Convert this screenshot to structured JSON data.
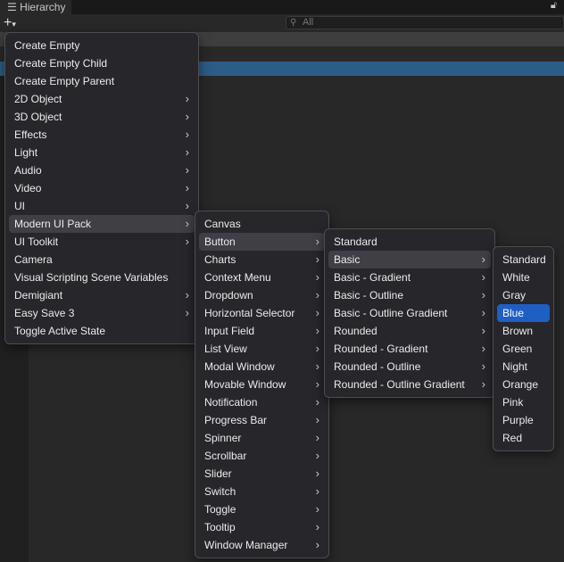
{
  "window": {
    "tab_title": "Hierarchy",
    "search_placeholder": "All"
  },
  "menu1": [
    {
      "label": "Create Empty",
      "sub": false
    },
    {
      "label": "Create Empty Child",
      "sub": false
    },
    {
      "label": "Create Empty Parent",
      "sub": false
    },
    {
      "label": "2D Object",
      "sub": true
    },
    {
      "label": "3D Object",
      "sub": true
    },
    {
      "label": "Effects",
      "sub": true
    },
    {
      "label": "Light",
      "sub": true
    },
    {
      "label": "Audio",
      "sub": true
    },
    {
      "label": "Video",
      "sub": true
    },
    {
      "label": "UI",
      "sub": true
    },
    {
      "label": "Modern UI Pack",
      "sub": true,
      "active": true
    },
    {
      "label": "UI Toolkit",
      "sub": true
    },
    {
      "label": "Camera",
      "sub": false
    },
    {
      "label": "Visual Scripting Scene Variables",
      "sub": false
    },
    {
      "label": "Demigiant",
      "sub": true
    },
    {
      "label": "Easy Save 3",
      "sub": true
    },
    {
      "label": "Toggle Active State",
      "sub": false
    }
  ],
  "menu2": [
    {
      "label": "Canvas",
      "sub": false
    },
    {
      "label": "Button",
      "sub": true,
      "active": true
    },
    {
      "label": "Charts",
      "sub": true
    },
    {
      "label": "Context Menu",
      "sub": true
    },
    {
      "label": "Dropdown",
      "sub": true
    },
    {
      "label": "Horizontal Selector",
      "sub": true
    },
    {
      "label": "Input Field",
      "sub": true
    },
    {
      "label": "List View",
      "sub": true
    },
    {
      "label": "Modal Window",
      "sub": true
    },
    {
      "label": "Movable Window",
      "sub": true
    },
    {
      "label": "Notification",
      "sub": true
    },
    {
      "label": "Progress Bar",
      "sub": true
    },
    {
      "label": "Spinner",
      "sub": true
    },
    {
      "label": "Scrollbar",
      "sub": true
    },
    {
      "label": "Slider",
      "sub": true
    },
    {
      "label": "Switch",
      "sub": true
    },
    {
      "label": "Toggle",
      "sub": true
    },
    {
      "label": "Tooltip",
      "sub": true
    },
    {
      "label": "Window Manager",
      "sub": true
    }
  ],
  "menu3": [
    {
      "label": "Standard",
      "sub": false
    },
    {
      "label": "Basic",
      "sub": true,
      "active": true
    },
    {
      "label": "Basic - Gradient",
      "sub": true
    },
    {
      "label": "Basic - Outline",
      "sub": true
    },
    {
      "label": "Basic - Outline Gradient",
      "sub": true
    },
    {
      "label": "Rounded",
      "sub": true
    },
    {
      "label": "Rounded - Gradient",
      "sub": true
    },
    {
      "label": "Rounded - Outline",
      "sub": true
    },
    {
      "label": "Rounded - Outline Gradient",
      "sub": true
    }
  ],
  "menu4": [
    {
      "label": "Standard"
    },
    {
      "label": "White"
    },
    {
      "label": "Gray"
    },
    {
      "label": "Blue",
      "selected": true
    },
    {
      "label": "Brown"
    },
    {
      "label": "Green"
    },
    {
      "label": "Night"
    },
    {
      "label": "Orange"
    },
    {
      "label": "Pink"
    },
    {
      "label": "Purple"
    },
    {
      "label": "Red"
    }
  ]
}
